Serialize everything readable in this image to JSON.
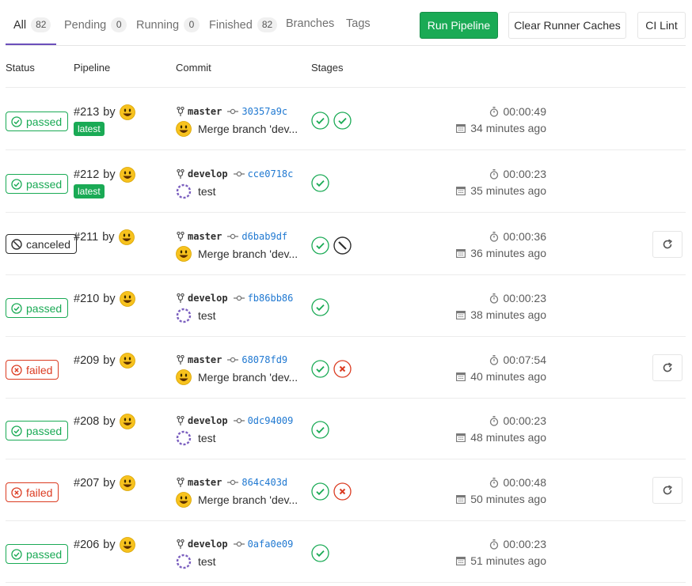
{
  "tabs": [
    {
      "label": "All",
      "count": "82"
    },
    {
      "label": "Pending",
      "count": "0"
    },
    {
      "label": "Running",
      "count": "0"
    },
    {
      "label": "Finished",
      "count": "82"
    },
    {
      "label": "Branches"
    },
    {
      "label": "Tags"
    }
  ],
  "buttons": {
    "run": "Run Pipeline",
    "clear": "Clear Runner Caches",
    "lint": "CI Lint"
  },
  "columns": {
    "status": "Status",
    "pipeline": "Pipeline",
    "commit": "Commit",
    "stages": "Stages"
  },
  "colors": {
    "success": "#1aaa55",
    "failed": "#db3b21",
    "canceled": "#2e2e2e",
    "link": "#1f78d1",
    "active_tab": "#6b4fbb"
  },
  "pipelines": [
    {
      "status": "passed",
      "id": "#213",
      "by": "by",
      "latest": "latest",
      "branch": "master",
      "sha": "30357a9c",
      "message": "Merge branch 'dev...",
      "stages": [
        "success",
        "success"
      ],
      "duration": "00:00:49",
      "finished": "34 minutes ago",
      "retry": false
    },
    {
      "status": "passed",
      "id": "#212",
      "by": "by",
      "latest": "latest",
      "branch": "develop",
      "sha": "cce0718c",
      "message": "test",
      "stages": [
        "success"
      ],
      "duration": "00:00:23",
      "finished": "35 minutes ago",
      "retry": false
    },
    {
      "status": "canceled",
      "id": "#211",
      "by": "by",
      "branch": "master",
      "sha": "d6bab9df",
      "message": "Merge branch 'dev...",
      "stages": [
        "success",
        "canceled"
      ],
      "duration": "00:00:36",
      "finished": "36 minutes ago",
      "retry": true
    },
    {
      "status": "passed",
      "id": "#210",
      "by": "by",
      "branch": "develop",
      "sha": "fb86bb86",
      "message": "test",
      "stages": [
        "success"
      ],
      "duration": "00:00:23",
      "finished": "38 minutes ago",
      "retry": false
    },
    {
      "status": "failed",
      "id": "#209",
      "by": "by",
      "branch": "master",
      "sha": "68078fd9",
      "message": "Merge branch 'dev...",
      "stages": [
        "success",
        "failed"
      ],
      "duration": "00:07:54",
      "finished": "40 minutes ago",
      "retry": true
    },
    {
      "status": "passed",
      "id": "#208",
      "by": "by",
      "branch": "develop",
      "sha": "0dc94009",
      "message": "test",
      "stages": [
        "success"
      ],
      "duration": "00:00:23",
      "finished": "48 minutes ago",
      "retry": false
    },
    {
      "status": "failed",
      "id": "#207",
      "by": "by",
      "branch": "master",
      "sha": "864c403d",
      "message": "Merge branch 'dev...",
      "stages": [
        "success",
        "failed"
      ],
      "duration": "00:00:48",
      "finished": "50 minutes ago",
      "retry": true
    },
    {
      "status": "passed",
      "id": "#206",
      "by": "by",
      "branch": "develop",
      "sha": "0afa0e09",
      "message": "test",
      "stages": [
        "success"
      ],
      "duration": "00:00:23",
      "finished": "51 minutes ago",
      "retry": false
    }
  ]
}
